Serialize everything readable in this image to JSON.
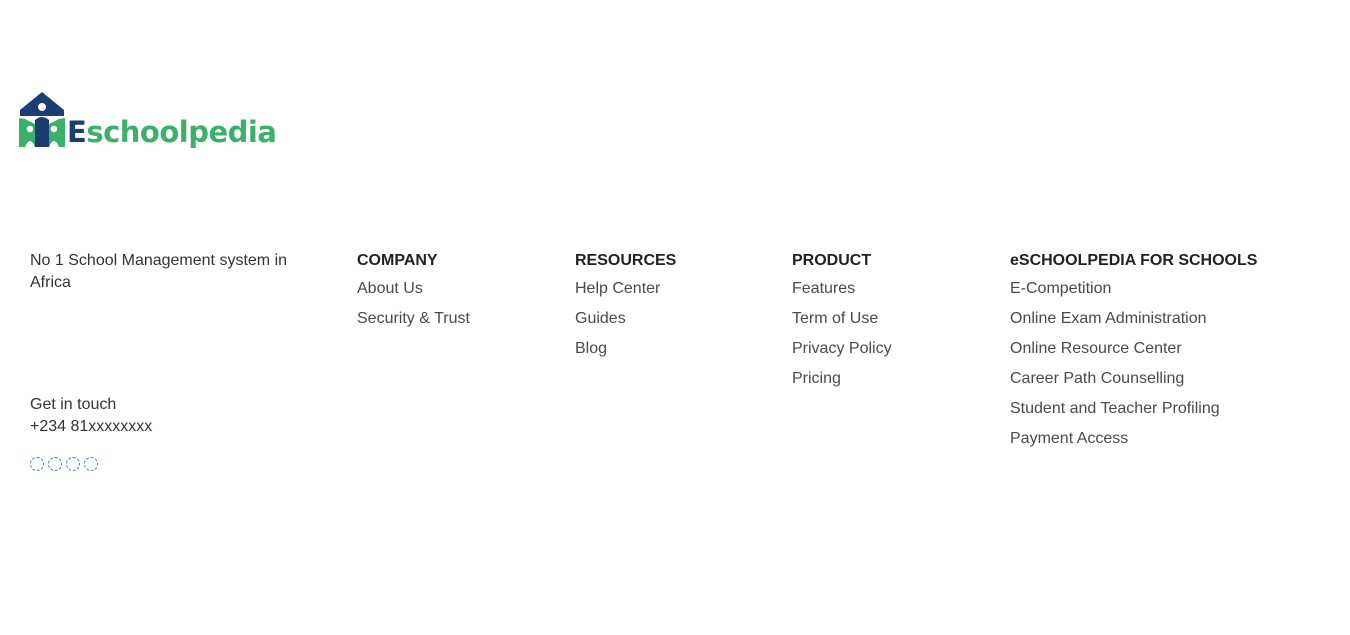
{
  "brand": {
    "logo_first_letter": "E",
    "logo_rest": "schoolpedia",
    "colors": {
      "navy": "#1c3d72",
      "green": "#3bb06b"
    }
  },
  "about": {
    "tagline": "No 1 School Management system in Africa",
    "contact_heading": "Get in touch",
    "phone": "+234 81xxxxxxxx",
    "social_icons": [
      "social-icon-1",
      "social-icon-2",
      "social-icon-3",
      "social-icon-4"
    ]
  },
  "company": {
    "title": "COMPANY",
    "links": [
      "About Us",
      "Security & Trust"
    ]
  },
  "resources": {
    "title": "RESOURCES",
    "links": [
      "Help Center",
      "Guides",
      "Blog"
    ]
  },
  "product": {
    "title": "PRODUCT",
    "links": [
      "Features",
      "Term of Use",
      "Privacy Policy",
      "Pricing"
    ]
  },
  "schools": {
    "title": "eSCHOOLPEDIA FOR SCHOOLS",
    "links": [
      "E-Competition",
      "Online Exam Administration",
      "Online Resource Center",
      "Career Path Counselling",
      "Student and Teacher Profiling",
      "Payment Access"
    ]
  }
}
